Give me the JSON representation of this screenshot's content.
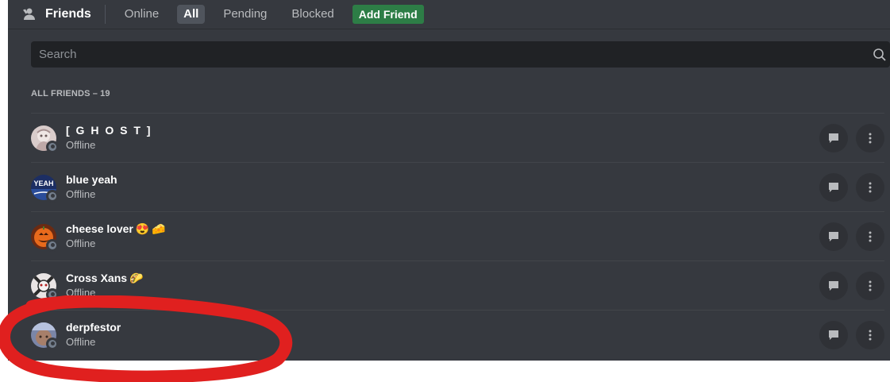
{
  "header": {
    "title": "Friends",
    "tabs": [
      {
        "label": "Online",
        "active": false
      },
      {
        "label": "All",
        "active": true
      },
      {
        "label": "Pending",
        "active": false
      },
      {
        "label": "Blocked",
        "active": false
      }
    ],
    "add_friend_label": "Add Friend"
  },
  "search": {
    "placeholder": "Search"
  },
  "section": {
    "label": "ALL FRIENDS",
    "separator": "–",
    "count": "19"
  },
  "friends": [
    {
      "name": "[ G H O S T ]",
      "status": "Offline",
      "emojis": []
    },
    {
      "name": "blue yeah",
      "status": "Offline",
      "emojis": []
    },
    {
      "name": "cheese lover",
      "status": "Offline",
      "emojis": [
        "😍",
        "🧀"
      ]
    },
    {
      "name": "Cross Xans",
      "status": "Offline",
      "emojis": [
        "🌮"
      ]
    },
    {
      "name": "derpfestor",
      "status": "Offline",
      "emojis": []
    }
  ],
  "avatar_texts": {
    "blue_yeah": "YEAH"
  },
  "icons": {
    "friends": "friends-wave-icon",
    "search": "search-icon",
    "message": "message-bubble-icon",
    "more": "more-vertical-icon"
  },
  "colors": {
    "background": "#36393f",
    "header_text": "#ffffff",
    "muted_text": "#b9bbbe",
    "add_friend": "#2d7d46",
    "search_bg": "#202225",
    "action_bg": "#2f3136",
    "offline": "#747f8d",
    "annotation": "#e0201f"
  }
}
